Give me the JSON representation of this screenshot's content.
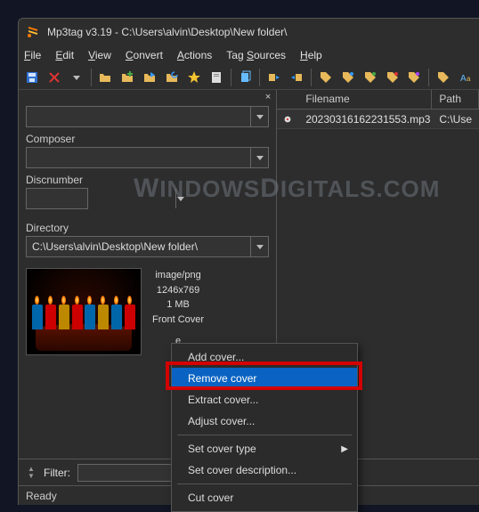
{
  "window": {
    "title": "Mp3tag v3.19  -  C:\\Users\\alvin\\Desktop\\New folder\\"
  },
  "menu": {
    "file": "File",
    "edit": "Edit",
    "view": "View",
    "convert": "Convert",
    "actions": "Actions",
    "tag_sources": "Tag Sources",
    "help": "Help"
  },
  "fields": {
    "composer_label": "Composer",
    "composer_value": "",
    "discnumber_label": "Discnumber",
    "discnumber_value": "",
    "directory_label": "Directory",
    "directory_value": "C:\\Users\\alvin\\Desktop\\New folder\\"
  },
  "cover": {
    "mime": "image/png",
    "dimensions": "1246x769",
    "size": "1 MB",
    "type": "Front Cover",
    "extra": "e"
  },
  "filelist": {
    "col_filename": "Filename",
    "col_path": "Path",
    "row1_name": "20230316162231553.mp3",
    "row1_path": "C:\\Use"
  },
  "context_menu": {
    "add": "Add cover...",
    "remove": "Remove cover",
    "extract": "Extract cover...",
    "adjust": "Adjust cover...",
    "set_type": "Set cover type",
    "set_desc": "Set cover description...",
    "cut": "Cut cover"
  },
  "filter": {
    "label": "Filter:",
    "value": ""
  },
  "status": {
    "ready": "Ready"
  },
  "watermark": {
    "text_w": "W",
    "text_rest1": "INDOWS",
    "text_d": "D",
    "text_rest2": "IGITALS.COM"
  }
}
